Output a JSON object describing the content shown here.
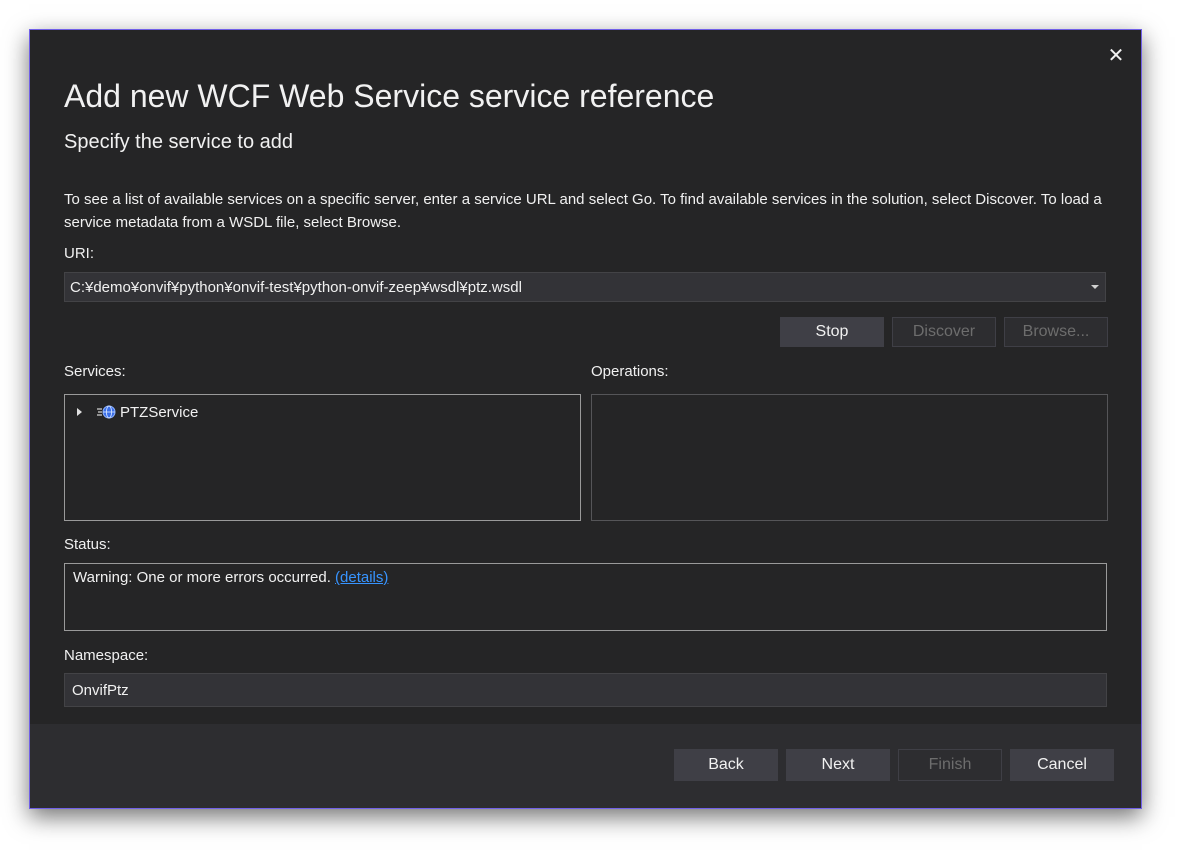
{
  "dialog": {
    "close_glyph": "✕",
    "title": "Add new WCF Web Service service reference",
    "subtitle": "Specify the service to add",
    "description": "To see a list of available services on a specific server, enter a service URL and select Go. To find available services in the solution, select Discover. To load a service metadata from a WSDL file, select Browse.",
    "accent_color": "#7160e8"
  },
  "uri": {
    "label": "URI:",
    "value": "C:¥demo¥onvif¥python¥onvif-test¥python-onvif-zeep¥wsdl¥ptz.wsdl"
  },
  "actions": {
    "stop_label": "Stop",
    "discover_label": "Discover",
    "browse_label": "Browse..."
  },
  "services": {
    "label": "Services:",
    "items": [
      {
        "label": "PTZService",
        "icon": "web-service-icon"
      }
    ]
  },
  "operations": {
    "label": "Operations:"
  },
  "status": {
    "label": "Status:",
    "text": "Warning: One or more errors occurred. ",
    "link": "(details)",
    "link_color": "#3794ff"
  },
  "namespace": {
    "label": "Namespace:",
    "value": "OnvifPtz"
  },
  "footer": {
    "back_label": "Back",
    "next_label": "Next",
    "finish_label": "Finish",
    "cancel_label": "Cancel"
  }
}
